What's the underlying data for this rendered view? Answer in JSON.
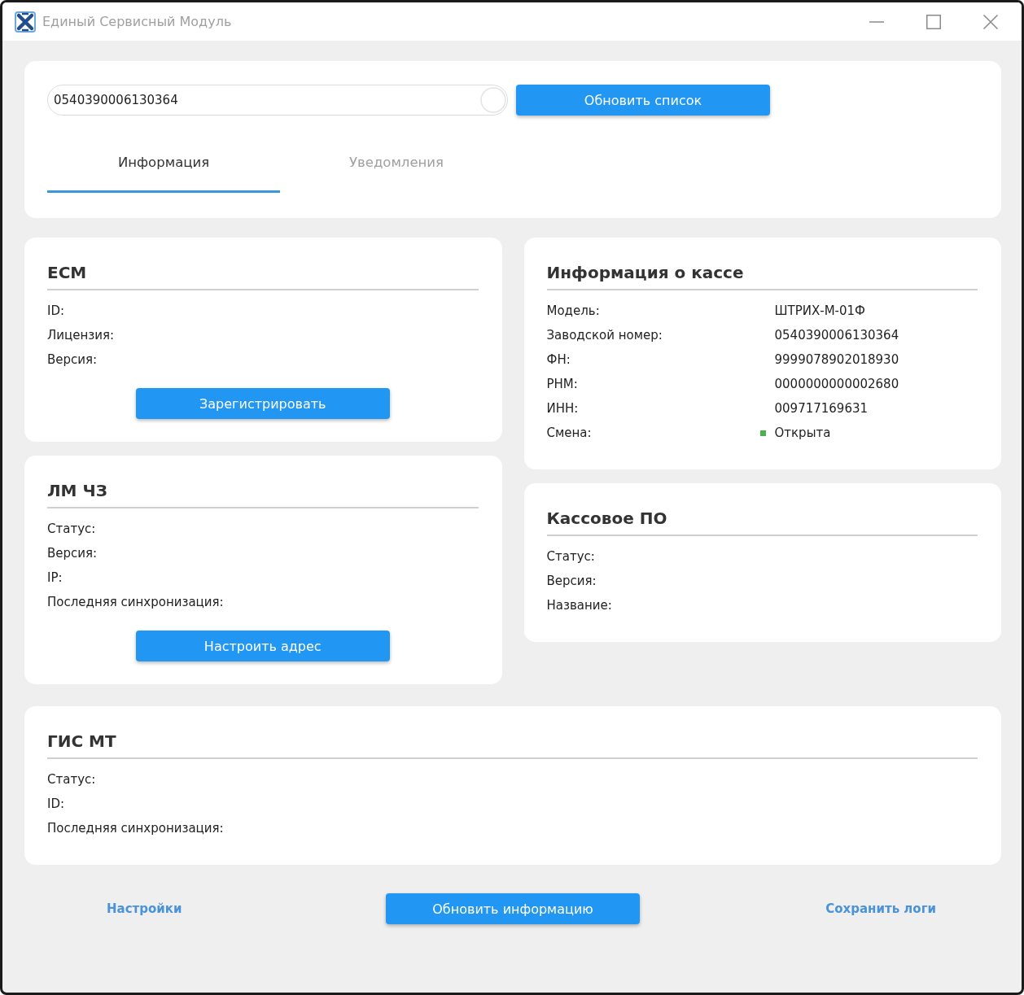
{
  "window": {
    "title": "Единый Сервисный Модуль"
  },
  "header": {
    "serial_field": {
      "value": "0540390006130364"
    },
    "button": "Обновить список"
  },
  "tabs": [
    {
      "label": "Информация",
      "selected": true
    },
    {
      "label": "Уведомления",
      "selected": false
    }
  ],
  "left_panels": [
    {
      "title": "ЕСМ",
      "rows": [
        {
          "label": "ID:"
        },
        {
          "label": "Лицензия:"
        },
        {
          "label": "Версия:"
        }
      ],
      "button": "Зарегистрировать"
    },
    {
      "title": "ЛМ ЧЗ",
      "rows": [
        {
          "label": "Статус:"
        },
        {
          "label": "Версия:"
        },
        {
          "label": "IP:"
        },
        {
          "label": "Последняя синхронизация:"
        }
      ],
      "button": "Настроить адрес"
    }
  ],
  "right_panels": [
    {
      "title": "Информация о кассе",
      "rows": [
        {
          "label": "Модель:",
          "value": "ШТРИХ-М-01Ф"
        },
        {
          "label": "Заводской номер:",
          "value": "0540390006130364"
        },
        {
          "label": "ФН:",
          "value": "9999078902018930"
        },
        {
          "label": "РНМ:",
          "value": "0000000000002680"
        },
        {
          "label": "ИНН:",
          "value": "009717169631"
        },
        {
          "label": "Смена:",
          "value": "Открыта",
          "color": "#4caf50"
        }
      ]
    },
    {
      "title": "Кассовое ПО",
      "rows": [
        {
          "label": "Статус:"
        },
        {
          "label": "Версия:"
        },
        {
          "label": "Название:"
        }
      ]
    }
  ],
  "wide_panel": {
    "title": "ГИС МТ",
    "rows": [
      {
        "label": "Статус:"
      },
      {
        "label": "ID:"
      },
      {
        "label": "Последняя синхронизация:"
      }
    ]
  },
  "footer": [
    {
      "kind": "link",
      "label": "Настройки"
    },
    {
      "kind": "button",
      "label": "Обновить информацию"
    },
    {
      "kind": "link",
      "label": "Сохранить логи"
    }
  ]
}
